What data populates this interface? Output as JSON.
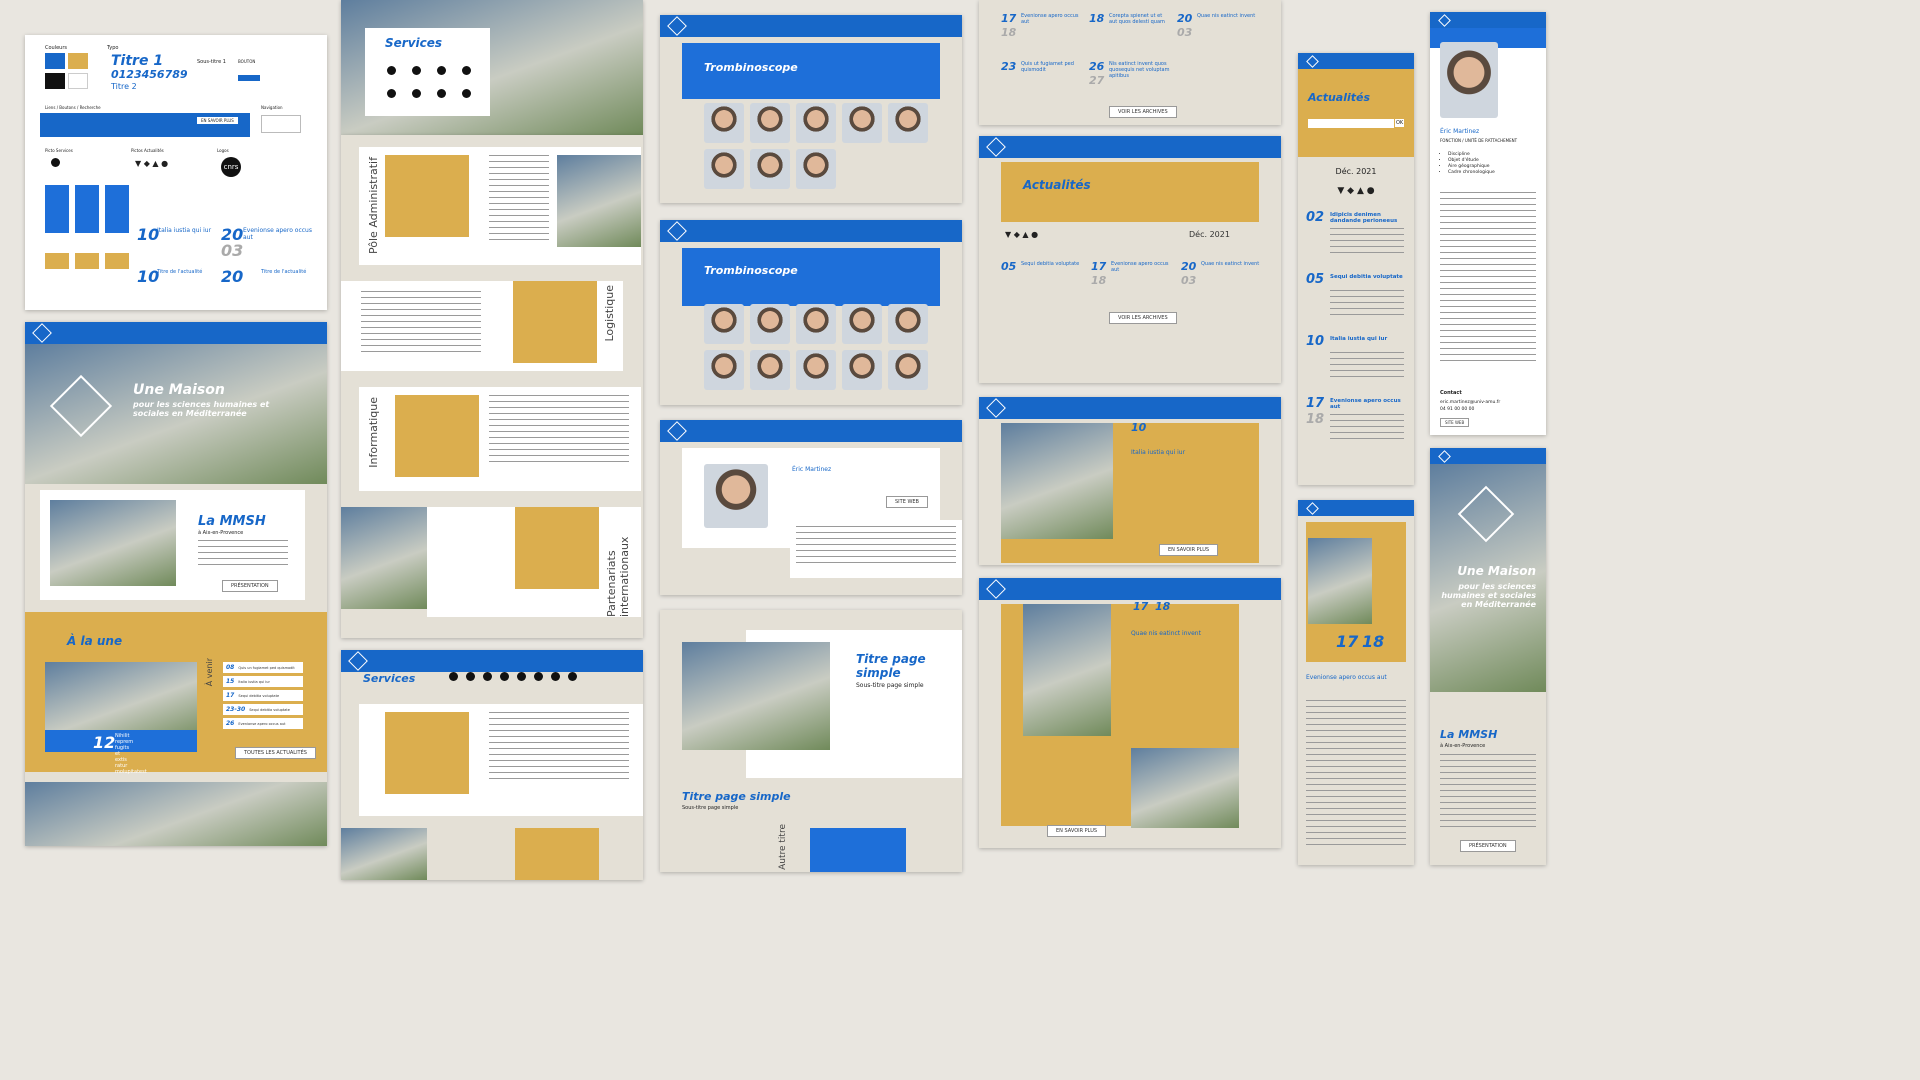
{
  "styleguide": {
    "colors_label": "Couleurs",
    "typo_label": "Typo",
    "title1": "Titre 1",
    "digits": "0123456789",
    "title2": "Titre 2",
    "subtitle": "Sous-titre 1",
    "button": "BOUTON",
    "links_label": "Liens / Boutons / Recherche",
    "nav_label": "Navigation",
    "pictos_label": "Picto Services",
    "pictos_news": "Pictos Actualités",
    "logos_label": "Logos",
    "logo_text": "cnrs",
    "more_label": "EN SAVOIR PLUS",
    "n10": "10",
    "n20": "20",
    "n03": "03",
    "event_title": "Evenionse apero occus aut",
    "news_title": "Italia iustia qui iur",
    "actu_title": "Titre de l'actualité"
  },
  "home": {
    "hero_title": "Une Maison",
    "hero_sub": "pour les sciences humaines et sociales en Méditerranée",
    "mmsh_title": "La MMSH",
    "mmsh_sub": "à Aix-en-Provence",
    "mmsh_btn": "PRÉSENTATION",
    "aune_title": "À la une",
    "avenir": "À venir",
    "feature_num": "12",
    "feature_text": "Nihilit reprem fugits et extis ratur molupitatest",
    "all_news": "TOUTES LES ACTUALITÉS",
    "list": [
      {
        "d": "08",
        "t": "Quis un fugiamet ped quismodit"
      },
      {
        "d": "15",
        "t": "Italia iustia qui iur"
      },
      {
        "d": "17",
        "t": "Sequi debitia voluptate"
      },
      {
        "d": "23-30",
        "t": "Sequi debitia voluptate"
      },
      {
        "d": "26",
        "t": "Evenionse apero occus aut"
      }
    ]
  },
  "services": {
    "title": "Services",
    "pole": "Pôle Administratif",
    "logistique": "Logistique",
    "informatique": "Informatique",
    "partenariats": "Partenariats internationaux",
    "title2": "Services"
  },
  "trombi": {
    "title": "Trombinoscope",
    "person": "Éric Martinez",
    "site_btn": "SITE WEB",
    "page_title": "Titre page simple",
    "page_sub": "Sous-titre page simple",
    "autre": "Autre titre"
  },
  "actus": {
    "title": "Actualités",
    "month": "Déc. 2021",
    "archive": "VOIR LES ARCHIVES",
    "items": [
      {
        "d": "17",
        "d2": "18",
        "t": "Evenionse apero occus aut"
      },
      {
        "d": "18",
        "t": "Corepta spienet ut et aut quos delesti quam"
      },
      {
        "d": "20",
        "d2": "03",
        "t": "Quae nis eatinct invent"
      },
      {
        "d": "23",
        "t": "Quis ut fugiamet ped quismodit"
      },
      {
        "d": "26",
        "d2": "27",
        "t": "Nis eatinct invent quos quosequis net voluptam apitibus"
      }
    ],
    "row2": [
      {
        "d": "05",
        "t": "Sequi debitia voluptate"
      },
      {
        "d": "17",
        "d2": "18",
        "t": "Evenionse apero occus aut"
      },
      {
        "d": "20",
        "d2": "03",
        "t": "Quae nis eatinct invent"
      }
    ],
    "detail1_num": "10",
    "detail1_title": "Italia iustia qui iur",
    "detail2_num": "17",
    "detail2_num2": "18",
    "detail2_title": "Quae nis eatinct invent",
    "more": "EN SAVOIR PLUS"
  },
  "mobile": {
    "actus_title": "Actualités",
    "month": "Déc. 2021",
    "search": "OK",
    "entries": [
      {
        "d": "02",
        "t": "Idipicis denimen dandande perioneeus"
      },
      {
        "d": "05",
        "t": "Sequi debitia voluptate"
      },
      {
        "d": "10",
        "t": "Italia iustia qui iur"
      },
      {
        "d": "17",
        "d2": "18",
        "t": "Evenionse apero occus aut"
      }
    ],
    "person": "Éric Martinez",
    "fonction": "FONCTION / UNITÉ DE RATTACHEMENT",
    "bullets": [
      "Discipline",
      "Objet d'étude",
      "Aire géographique",
      "Cadre chronologique"
    ],
    "contact": "Contact",
    "email": "eric.martinez@univ-amu.fr",
    "phone": "04 91 00 00 00",
    "site": "SITE WEB",
    "event_num": "17",
    "event_num2": "18",
    "event_title": "Evenionse apero occus aut",
    "hero_title": "Une Maison",
    "hero_sub": "pour les sciences humaines et sociales en Méditerranée",
    "mmsh": "La MMSH",
    "mmsh_sub": "à Aix-en-Provence",
    "pres": "PRÉSENTATION"
  },
  "colors": {
    "blue": "#1767c8",
    "gold": "#dbae4e",
    "beige": "#e4e0d6"
  }
}
